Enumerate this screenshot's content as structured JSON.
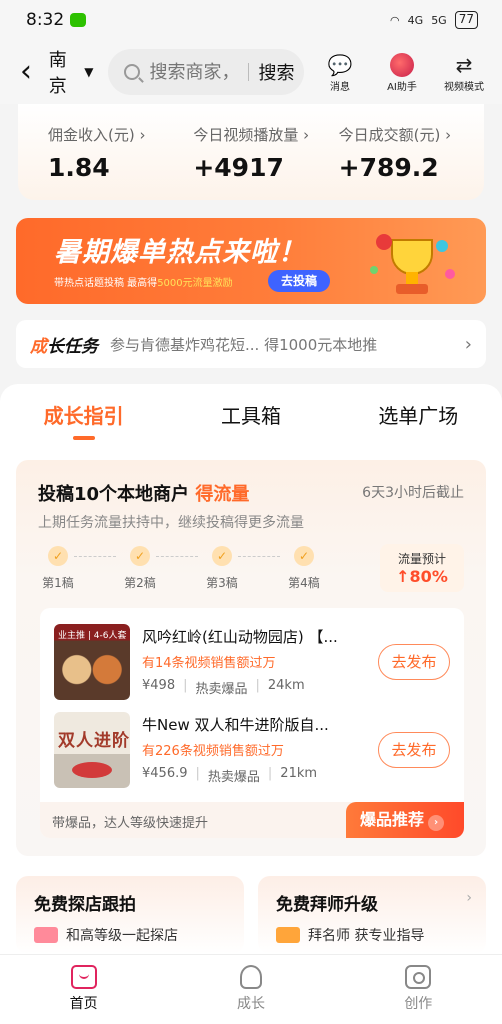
{
  "status_bar": {
    "time": "8:32",
    "signal_1": "4G",
    "signal_2": "5G",
    "battery": "77"
  },
  "header": {
    "city": "南京",
    "search_placeholder": "搜索商家，",
    "search_button": "搜索",
    "actions": [
      {
        "label": "消息",
        "icon": "message-icon"
      },
      {
        "label": "AI助手",
        "icon": "ai-assistant-icon"
      },
      {
        "label": "视频模式",
        "icon": "swap-icon"
      }
    ]
  },
  "stats": [
    {
      "label": "佣金收入(元)",
      "value": "1.84"
    },
    {
      "label": "今日视频播放量",
      "value": "+4917"
    },
    {
      "label": "今日成交额(元)",
      "value": "+789.2"
    }
  ],
  "banner": {
    "title": "暑期爆单热点来啦！",
    "subtitle_prefix": "带热点话题投稿 最高得",
    "subtitle_highlight": "5000元流量激励",
    "cta": "去投稿",
    "colors": {
      "accent": "#ff6a2a",
      "cta": "#3e63ff"
    }
  },
  "task": {
    "title_first": "成",
    "title_rest": "长任务",
    "description": "参与肯德基炸鸡花短... 得1000元本地推"
  },
  "tabs": [
    {
      "label": "成长指引",
      "active": true
    },
    {
      "label": "工具箱",
      "active": false
    },
    {
      "label": "选单广场",
      "active": false
    }
  ],
  "quest": {
    "title": "投稿10个本地商户",
    "title_highlight": "得流量",
    "deadline": "6天3小时后截止",
    "subtitle": "上期任务流量扶持中，继续投稿得更多流量",
    "steps": [
      "第1稿",
      "第2稿",
      "第3稿",
      "第4稿"
    ],
    "forecast_label": "流量预计",
    "forecast_value": "↑80%"
  },
  "products": [
    {
      "thumb_tag": "业主推 | 4-6人套",
      "name": "风吟红岭(红山动物园店) 【...",
      "sales": "有14条视频销售额过万",
      "price": "¥498",
      "tag": "热卖爆品",
      "distance": "24km",
      "button": "去发布"
    },
    {
      "thumb_tag": "双人进阶",
      "name": "牛New 双人和牛进阶版自...",
      "sales": "有226条视频销售额过万",
      "price": "¥456.9",
      "tag": "热卖爆品",
      "distance": "21km",
      "button": "去发布"
    }
  ],
  "product_footer": {
    "text": "带爆品，达人等级快速提升",
    "button": "爆品推荐"
  },
  "bottom_cards": [
    {
      "title": "免费探店跟拍",
      "sub": "和高等级一起探店"
    },
    {
      "title": "免费拜师升级",
      "sub": "拜名师 获专业指导"
    }
  ],
  "tab_bar": [
    {
      "label": "首页",
      "active": true
    },
    {
      "label": "成长",
      "active": false
    },
    {
      "label": "创作",
      "active": false
    }
  ]
}
